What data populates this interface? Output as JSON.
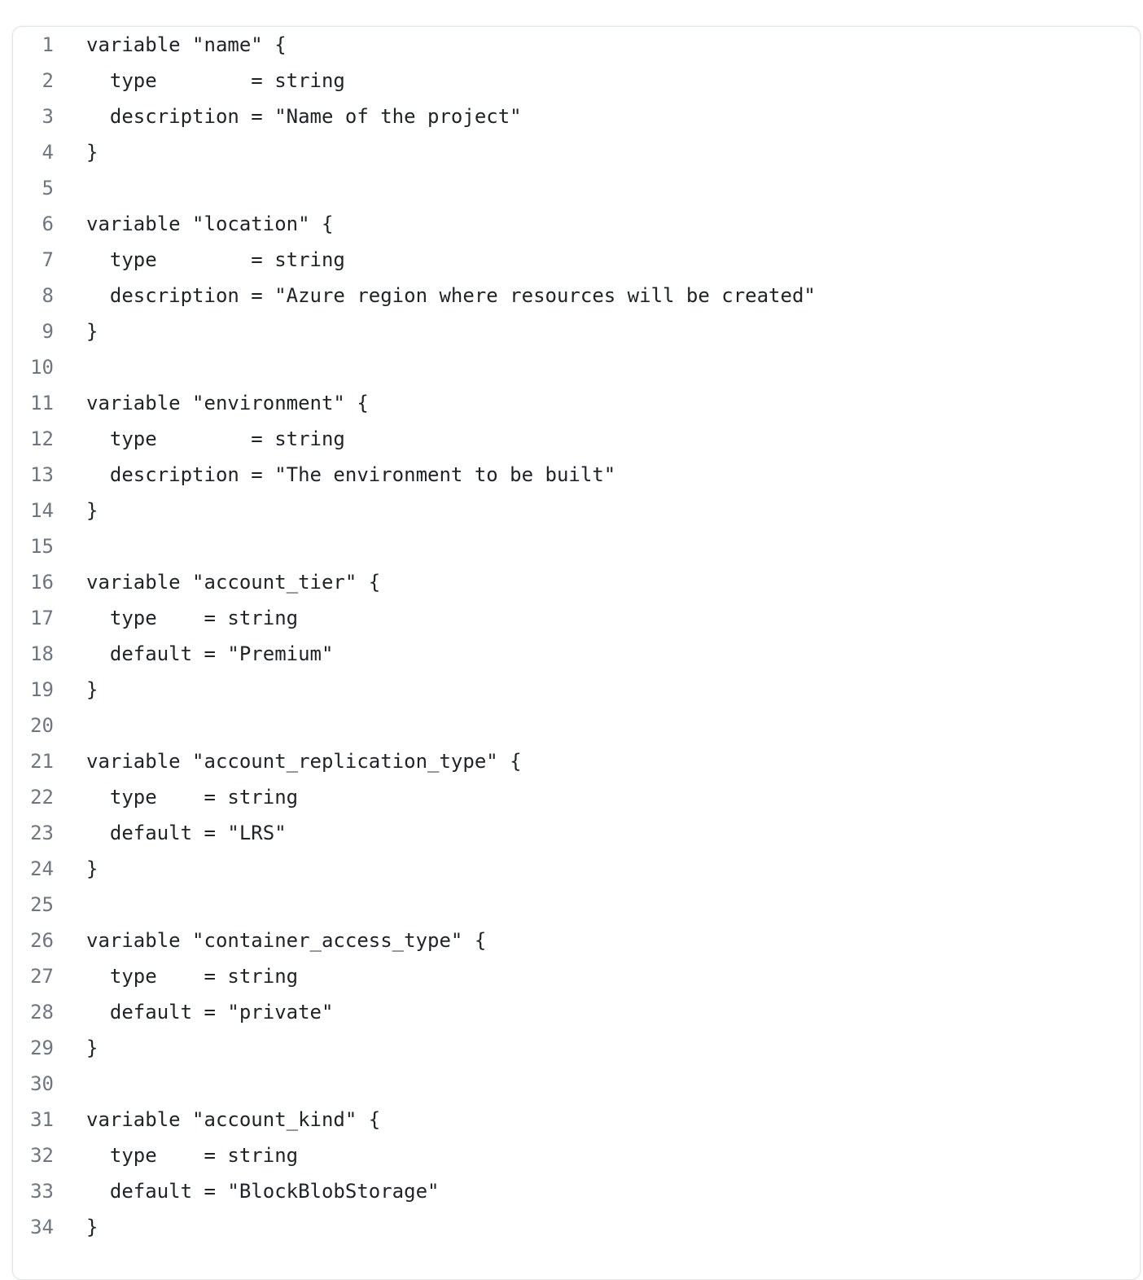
{
  "code_view": {
    "language": "terraform",
    "lines": [
      {
        "number": "1",
        "text": "variable \"name\" {"
      },
      {
        "number": "2",
        "text": "  type        = string"
      },
      {
        "number": "3",
        "text": "  description = \"Name of the project\""
      },
      {
        "number": "4",
        "text": "}"
      },
      {
        "number": "5",
        "text": ""
      },
      {
        "number": "6",
        "text": "variable \"location\" {"
      },
      {
        "number": "7",
        "text": "  type        = string"
      },
      {
        "number": "8",
        "text": "  description = \"Azure region where resources will be created\""
      },
      {
        "number": "9",
        "text": "}"
      },
      {
        "number": "10",
        "text": ""
      },
      {
        "number": "11",
        "text": "variable \"environment\" {"
      },
      {
        "number": "12",
        "text": "  type        = string"
      },
      {
        "number": "13",
        "text": "  description = \"The environment to be built\""
      },
      {
        "number": "14",
        "text": "}"
      },
      {
        "number": "15",
        "text": ""
      },
      {
        "number": "16",
        "text": "variable \"account_tier\" {"
      },
      {
        "number": "17",
        "text": "  type    = string"
      },
      {
        "number": "18",
        "text": "  default = \"Premium\""
      },
      {
        "number": "19",
        "text": "}"
      },
      {
        "number": "20",
        "text": ""
      },
      {
        "number": "21",
        "text": "variable \"account_replication_type\" {"
      },
      {
        "number": "22",
        "text": "  type    = string"
      },
      {
        "number": "23",
        "text": "  default = \"LRS\""
      },
      {
        "number": "24",
        "text": "}"
      },
      {
        "number": "25",
        "text": ""
      },
      {
        "number": "26",
        "text": "variable \"container_access_type\" {"
      },
      {
        "number": "27",
        "text": "  type    = string"
      },
      {
        "number": "28",
        "text": "  default = \"private\""
      },
      {
        "number": "29",
        "text": "}"
      },
      {
        "number": "30",
        "text": ""
      },
      {
        "number": "31",
        "text": "variable \"account_kind\" {"
      },
      {
        "number": "32",
        "text": "  type    = string"
      },
      {
        "number": "33",
        "text": "  default = \"BlockBlobStorage\""
      },
      {
        "number": "34",
        "text": "}"
      }
    ]
  },
  "colors": {
    "line_number": "#6e7781",
    "code_text": "#1f2328",
    "border": "#e3e6ea",
    "background": "#ffffff"
  }
}
